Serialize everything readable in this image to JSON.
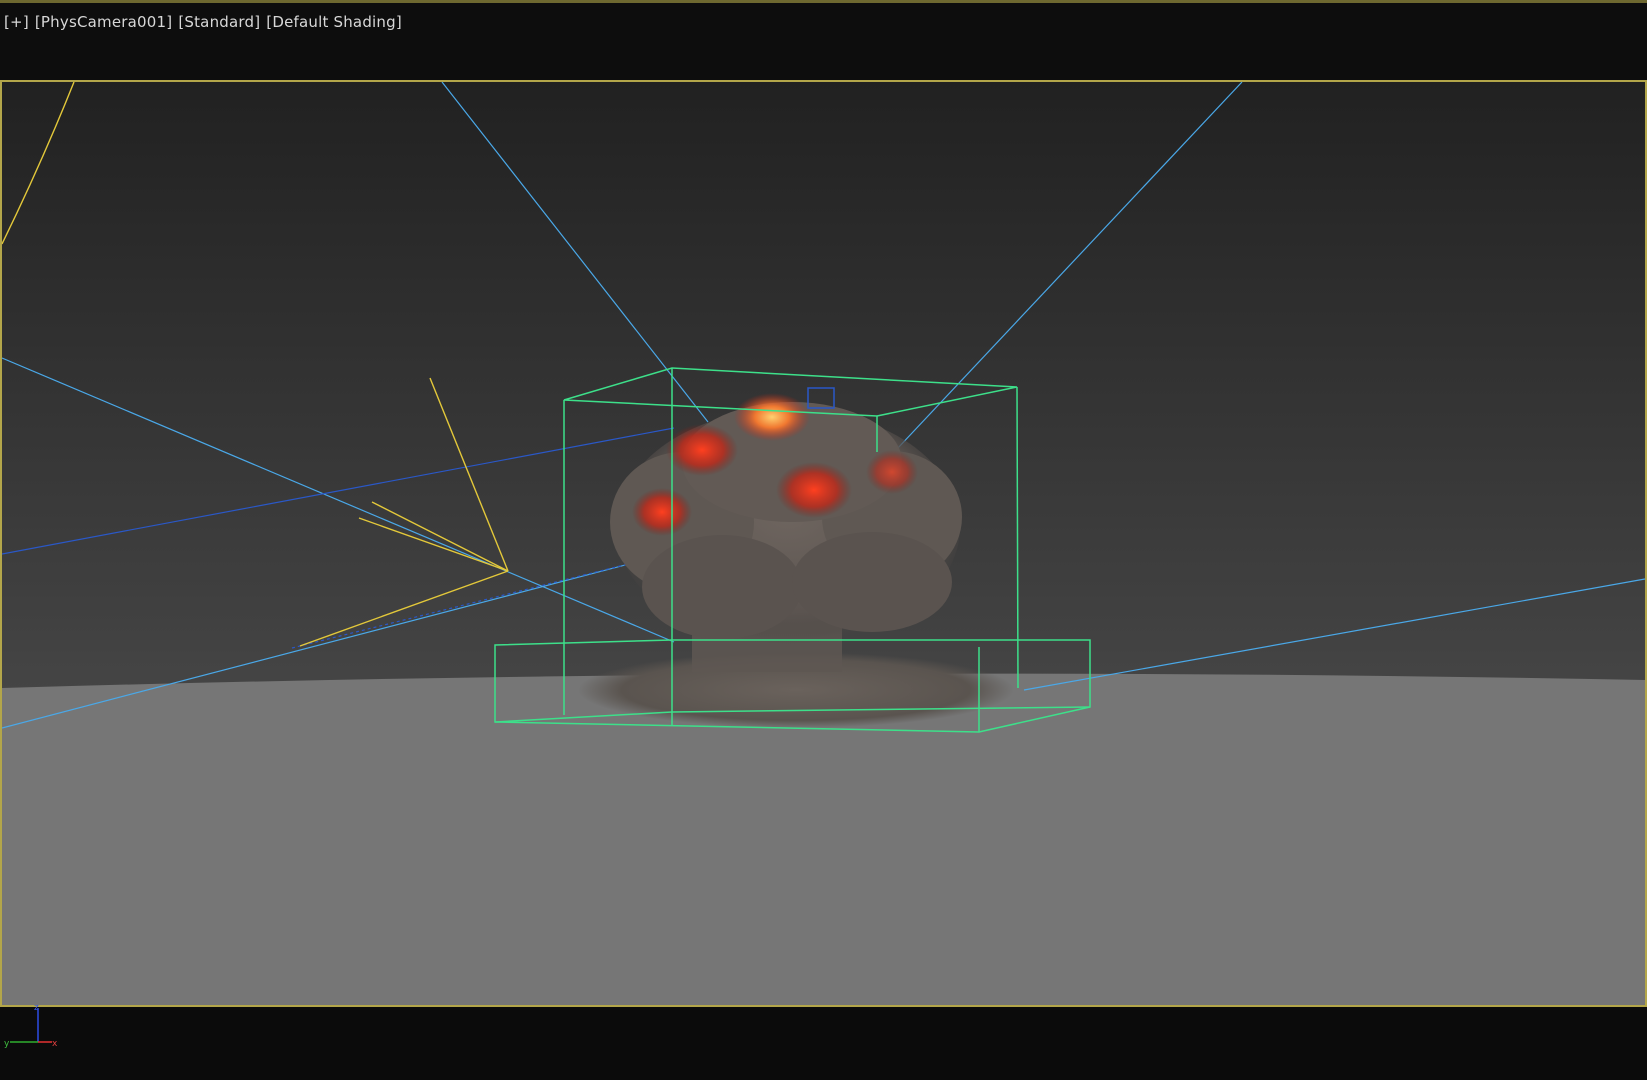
{
  "viewport": {
    "label_items": [
      "[+]",
      "[PhysCamera001]",
      "[Standard]",
      "[Default Shading]"
    ]
  },
  "axis_gizmo": {
    "x": "x",
    "y": "y",
    "z": "z"
  },
  "colors": {
    "frame_active": "#b3a64a",
    "sky_top": "#222222",
    "sky_bottom": "#424242",
    "ground": "#767676",
    "wireframe_green": "#3de08a",
    "camera_cyan": "#4aa8e8",
    "camera_blue": "#2a58c8",
    "light_yellow": "#e3c83a",
    "fire_orange": "#f08030",
    "fire_red": "#d83020",
    "smoke": "#6a625c"
  }
}
